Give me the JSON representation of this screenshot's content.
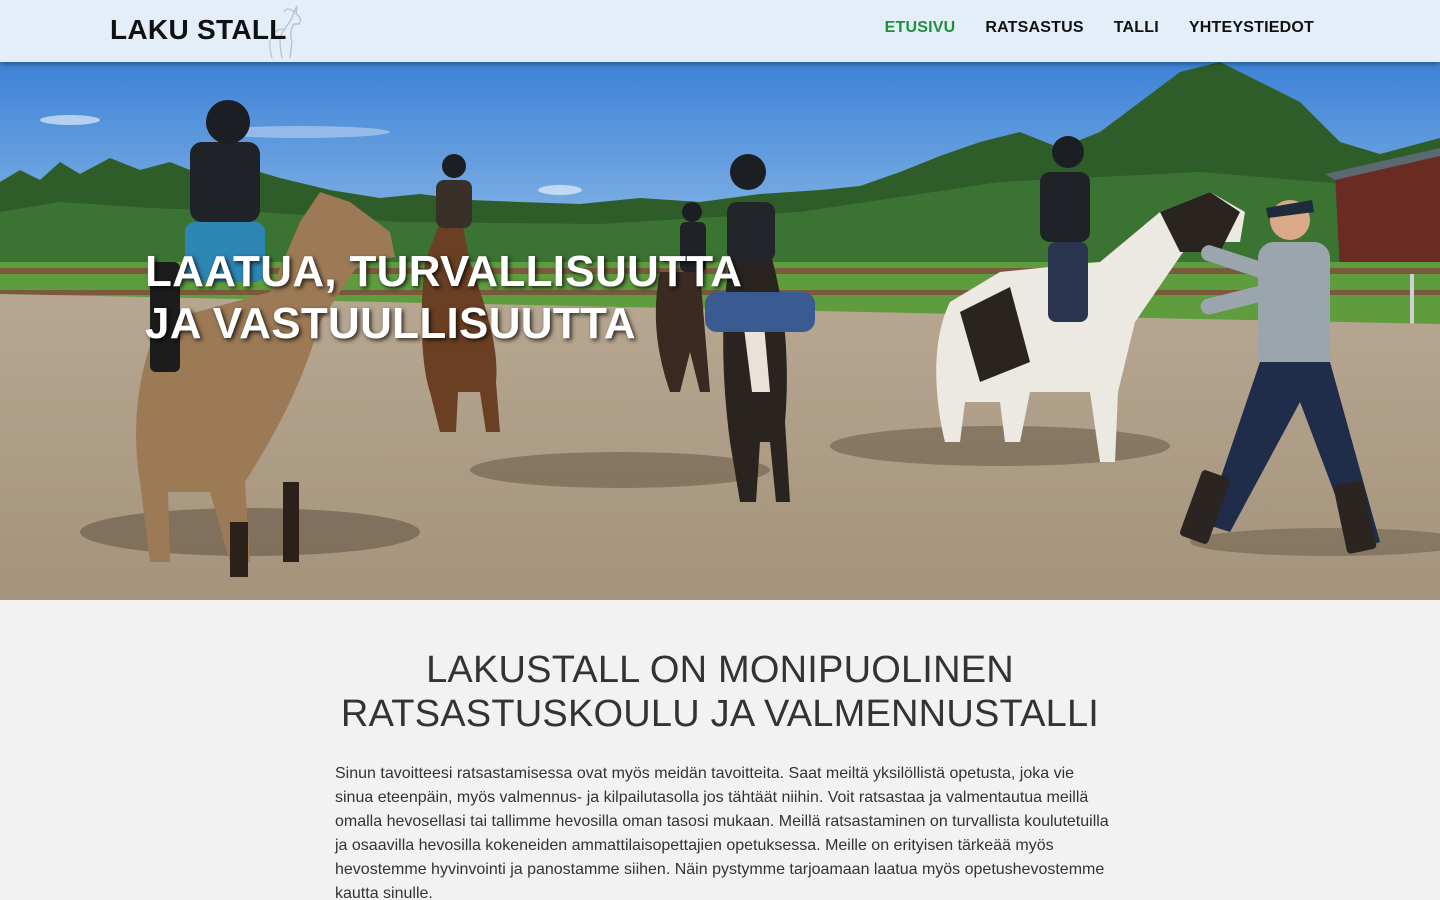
{
  "header": {
    "logo_text": "LAKU STALL",
    "logo_icon": "horse-logo-icon",
    "nav": [
      {
        "label": "ETUSIVU",
        "active": true
      },
      {
        "label": "RATSASTUS",
        "active": false
      },
      {
        "label": "TALLI",
        "active": false
      },
      {
        "label": "YHTEYSTIEDOT",
        "active": false
      }
    ],
    "active_color": "#1f8f3a"
  },
  "hero": {
    "title_line1": "LAATUA, TURVALLISUUTTA",
    "title_line2": "JA VASTUULLISUUTTA"
  },
  "intro": {
    "heading_line1": "LAKUSTALL ON MONIPUOLINEN",
    "heading_line2": "RATSASTUSKOULU JA VALMENNUSTALLI",
    "body": "Sinun tavoitteesi ratsastamisessa ovat myös meidän tavoitteita. Saat meiltä yksilöllistä opetusta, joka vie sinua eteenpäin, myös valmennus- ja kilpailutasolla jos tähtäät niihin. Voit ratsastaa ja valmentautua meillä omalla hevosellasi tai tallimme hevosilla oman tasosi mukaan. Meillä ratsastaminen on turvallista koulutetuilla ja osaavilla hevosilla kokeneiden ammattilaisopettajien opetuksessa. Meille on erityisen tärkeää myös hevostemme hyvinvointi ja panostamme siihen. Näin pystymme tarjoamaan laatua myös opetushevostemme kautta sinulle."
  }
}
